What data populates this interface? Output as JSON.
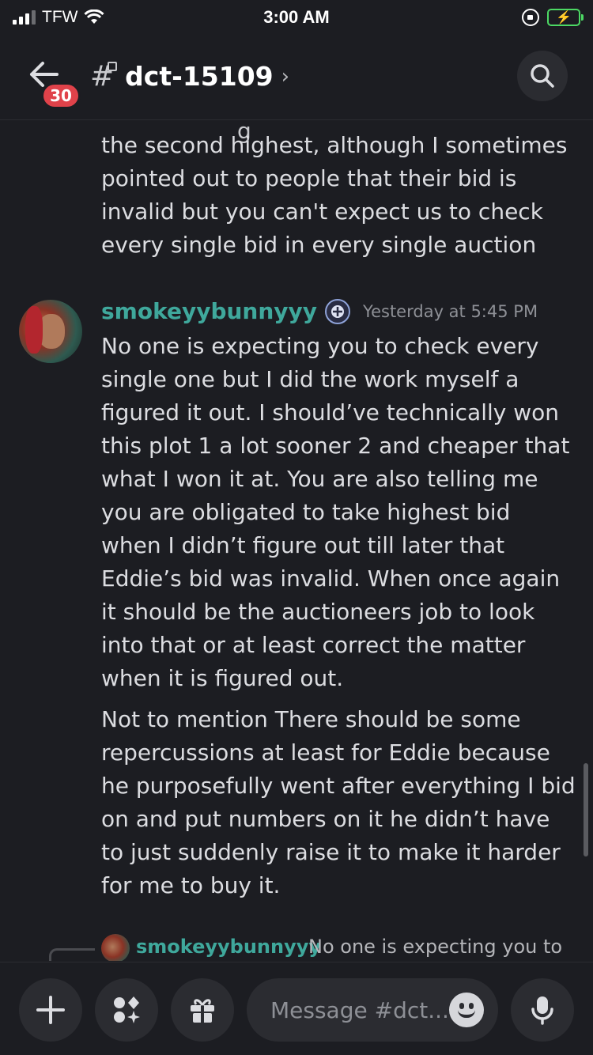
{
  "status_bar": {
    "carrier": "TFW",
    "time": "3:00 AM"
  },
  "header": {
    "unread_count": "30",
    "channel_name": "dct-15109",
    "chevron": "›"
  },
  "messages": {
    "cutoff_fragment": "g",
    "continued_text": "the second highest, although I sometimes pointed out to people that their bid is invalid but you can't expect us to check every single bid in every single auction",
    "author": "smokeyybunnyyy",
    "timestamp": "Yesterday at 5:45 PM",
    "body_1": "No one is expecting you to check every single one but I did the work myself a figured it out.  I should’ve technically won this plot 1 a lot sooner 2 and cheaper that what I won it at. You are also telling me you are obligated to take highest bid when I didn’t figure out till later that Eddie’s bid was invalid. When once again it should be the auctioneers job to look into that or at least correct the matter when it is figured out.",
    "body_2": "Not to mention There should be some repercussions at least for Eddie because he purposefully went after everything I bid on and put numbers on it he didn’t have to just suddenly raise it to make it harder for me to buy it."
  },
  "reply_preview": {
    "author": "smokeyybunnyyy",
    "text": "No one is expecting you to"
  },
  "composer": {
    "placeholder": "Message #dct..."
  },
  "icons": {
    "back": "arrow-left-icon",
    "channel": "hashtag-thread-icon",
    "search": "search-icon",
    "plus": "plus-icon",
    "apps": "apps-icon",
    "gift": "gift-icon",
    "emoji": "emoji-icon",
    "mic": "microphone-icon"
  },
  "colors": {
    "background": "#1c1d22",
    "username": "#3fa89c",
    "badge": "#e0424a",
    "battery": "#4cd964"
  }
}
